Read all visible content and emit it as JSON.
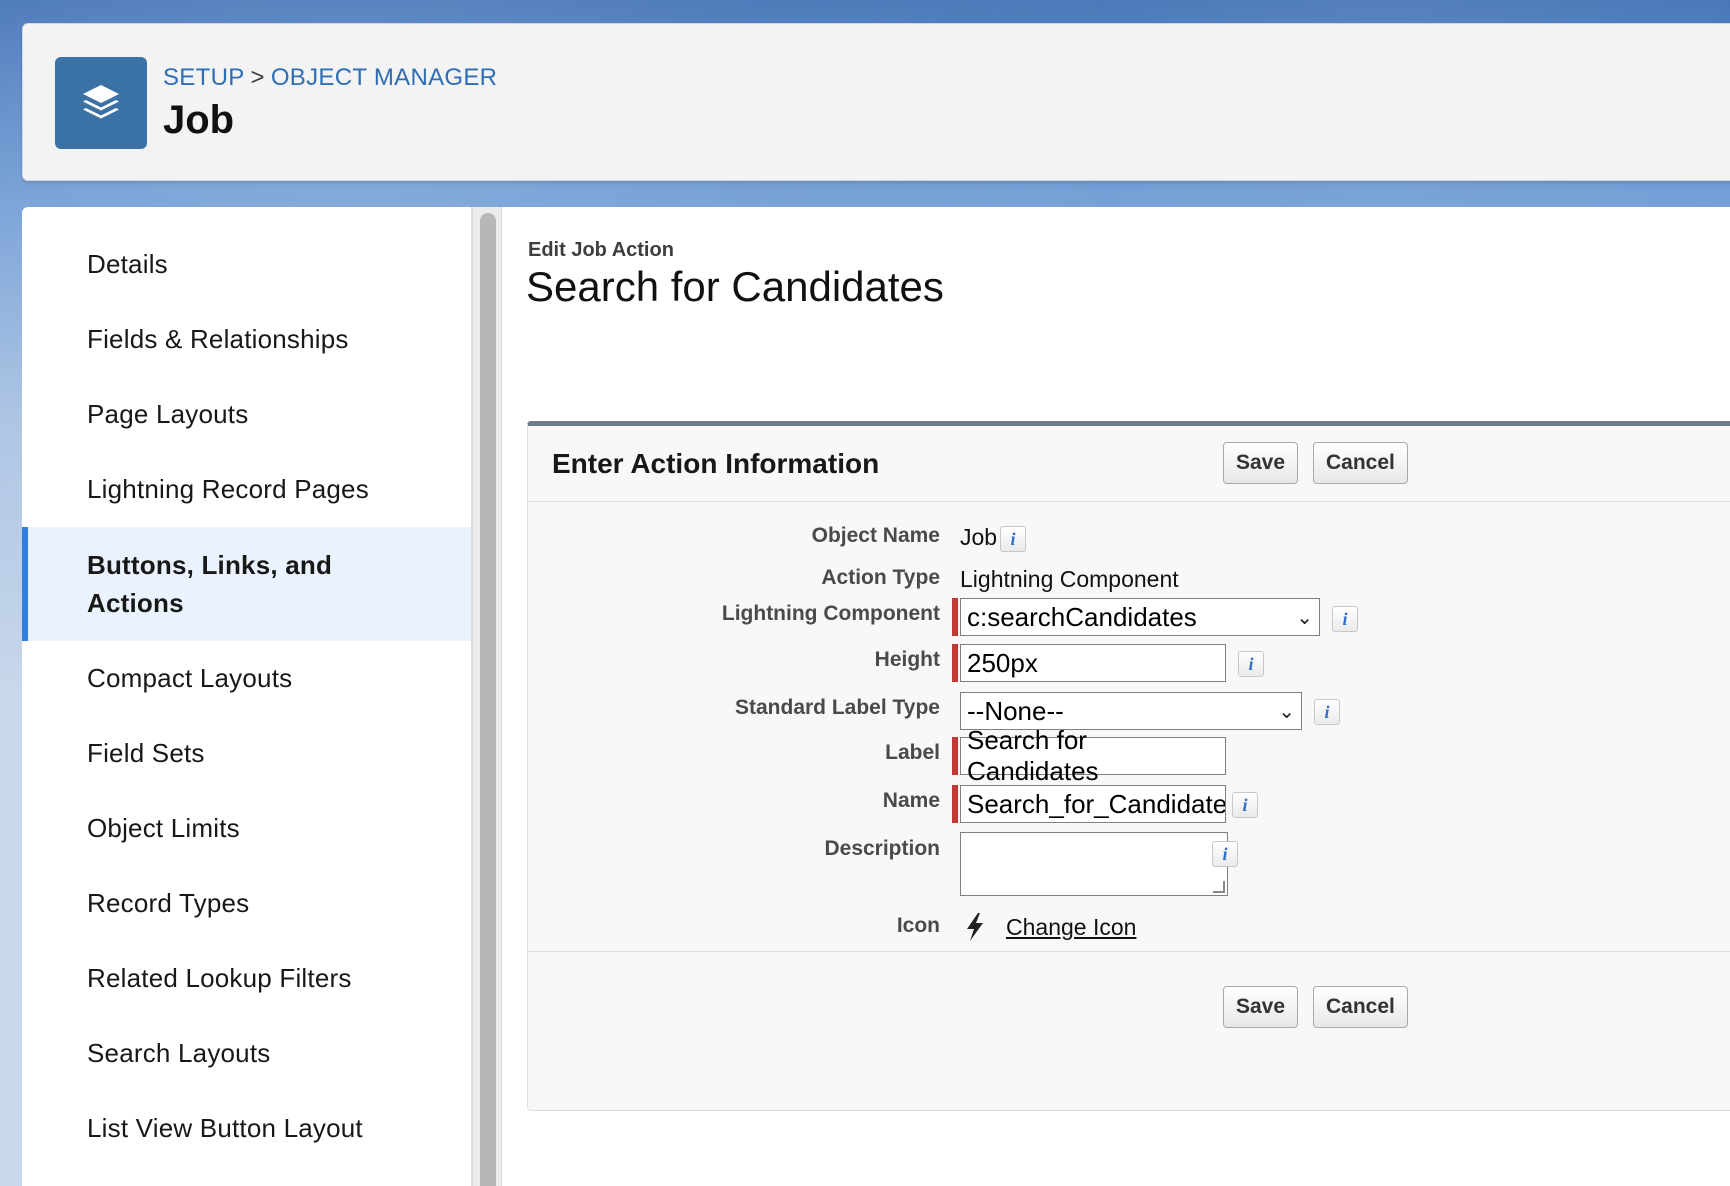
{
  "header": {
    "breadcrumb": [
      "SETUP",
      ">",
      "OBJECT MANAGER"
    ],
    "object_title": "Job",
    "icon": "layers-icon"
  },
  "sidebar": {
    "items": [
      {
        "label": "Details"
      },
      {
        "label": "Fields & Relationships"
      },
      {
        "label": "Page Layouts"
      },
      {
        "label": "Lightning Record Pages"
      },
      {
        "label": "Buttons, Links, and Actions",
        "active": true
      },
      {
        "label": "Compact Layouts"
      },
      {
        "label": "Field Sets"
      },
      {
        "label": "Object Limits"
      },
      {
        "label": "Record Types"
      },
      {
        "label": "Related Lookup Filters"
      },
      {
        "label": "Search Layouts"
      },
      {
        "label": "List View Button Layout"
      }
    ]
  },
  "main": {
    "subtitle": "Edit Job Action",
    "title": "Search for Candidates",
    "panel": {
      "heading": "Enter Action Information",
      "save_label": "Save",
      "cancel_label": "Cancel",
      "fields": {
        "object_name": {
          "label": "Object Name",
          "value": "Job"
        },
        "action_type": {
          "label": "Action Type",
          "value": "Lightning Component"
        },
        "lightning_component": {
          "label": "Lightning Component",
          "value": "c:searchCandidates"
        },
        "height": {
          "label": "Height",
          "value": "250px"
        },
        "standard_label_type": {
          "label": "Standard Label Type",
          "value": "--None--"
        },
        "label": {
          "label": "Label",
          "value": "Search for Candidates"
        },
        "name": {
          "label": "Name",
          "value": "Search_for_Candidates"
        },
        "description": {
          "label": "Description",
          "value": ""
        },
        "icon": {
          "label": "Icon",
          "link": "Change Icon",
          "icon": "lightning-bolt-icon"
        }
      },
      "info_glyph": "i"
    }
  },
  "colors": {
    "brand_blue": "#3b72a6",
    "active_border": "#2f80e0",
    "required_red": "#c23934",
    "link_blue": "#2e6eb4"
  }
}
